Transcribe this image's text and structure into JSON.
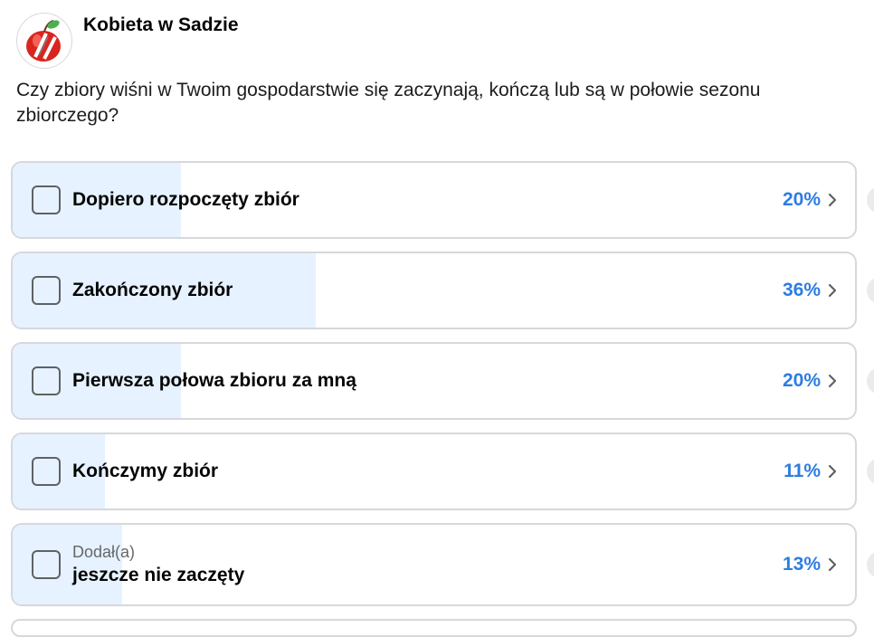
{
  "group": {
    "name": "Kobieta w Sadzie"
  },
  "poll": {
    "question": "Czy zbiory wiśni w Twoim gospodarstwie się zaczynają, kończą lub są w połowie sezonu zbiorczego?",
    "options": [
      {
        "label": "Dopiero rozpoczęty zbiór",
        "percent_label": "20%",
        "percent": 20
      },
      {
        "label": "Zakończony zbiór",
        "percent_label": "36%",
        "percent": 36
      },
      {
        "label": "Pierwsza połowa zbioru za mną",
        "percent_label": "20%",
        "percent": 20
      },
      {
        "label": "Kończymy zbiór",
        "percent_label": "11%",
        "percent": 11
      },
      {
        "added_by": "Dodał(a)",
        "label": "jeszcze nie zaczęty",
        "percent_label": "13%",
        "percent": 13
      }
    ]
  },
  "icons": {
    "avatar": "apple-logo-icon",
    "chevron": "chevron-right-icon",
    "checkbox": "checkbox-icon"
  },
  "colors": {
    "accent": "#2d7de0",
    "bar_fill": "#e6f2ff",
    "border": "#d6d8dc"
  }
}
